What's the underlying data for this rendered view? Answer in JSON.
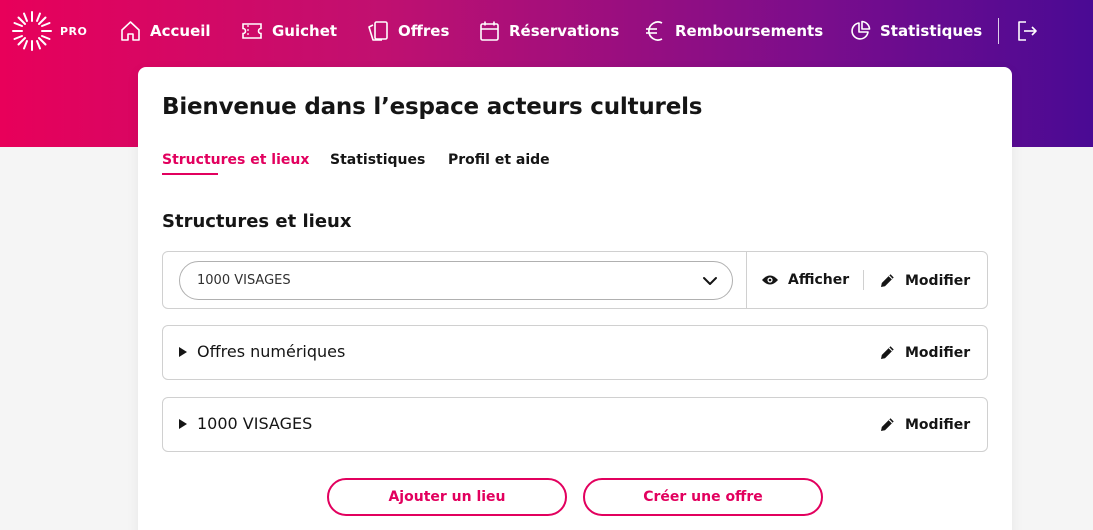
{
  "nav": {
    "logo_badge": "PRO",
    "items": [
      {
        "label": "Accueil",
        "icon": "home-icon"
      },
      {
        "label": "Guichet",
        "icon": "ticket-icon"
      },
      {
        "label": "Offres",
        "icon": "offers-icon"
      },
      {
        "label": "Réservations",
        "icon": "calendar-icon"
      },
      {
        "label": "Remboursements",
        "icon": "euro-icon"
      },
      {
        "label": "Statistiques",
        "icon": "pie-chart-icon"
      }
    ],
    "logout_icon": "logout-icon"
  },
  "page": {
    "title": "Bienvenue dans l’espace acteurs culturels",
    "tabs": [
      {
        "label": "Structures et lieux",
        "active": true
      },
      {
        "label": "Statistiques",
        "active": false
      },
      {
        "label": "Profil et aide",
        "active": false
      }
    ],
    "section_title": "Structures et lieux",
    "structure_select": {
      "value": "1000 VISAGES",
      "show_label": "Afficher",
      "edit_label": "Modifier"
    },
    "venues": [
      {
        "label": "Offres numériques",
        "edit_label": "Modifier"
      },
      {
        "label": "1000 VISAGES",
        "edit_label": "Modifier"
      }
    ],
    "buttons": {
      "add_venue": "Ajouter un lieu",
      "create_offer": "Créer une offre"
    }
  },
  "colors": {
    "accent": "#e2005e",
    "banner_start": "#e8005a",
    "banner_end": "#4a0a94"
  }
}
